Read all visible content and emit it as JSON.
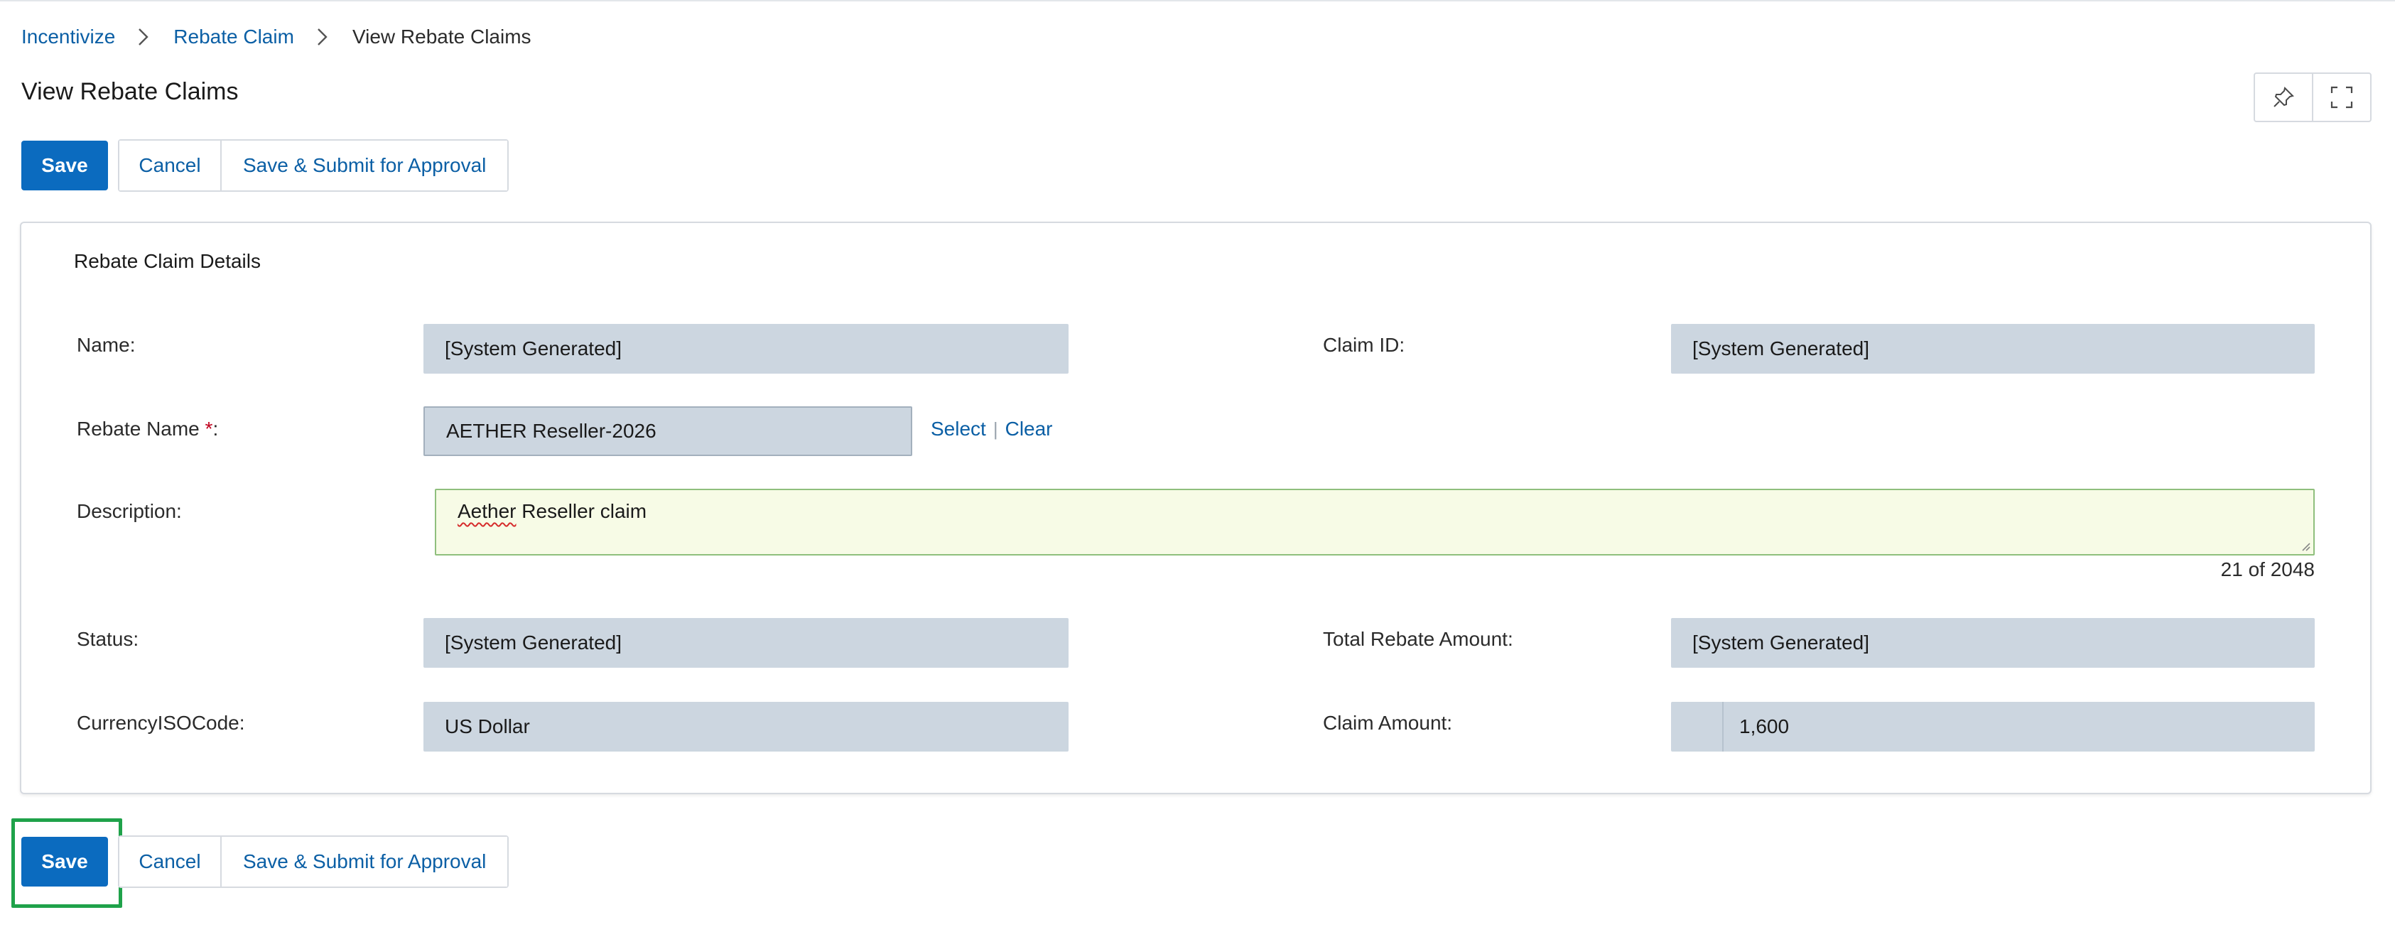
{
  "breadcrumb": {
    "items": [
      "Incentivize",
      "Rebate Claim"
    ],
    "current": "View Rebate Claims"
  },
  "page": {
    "title": "View Rebate Claims"
  },
  "icons": {
    "pin": "pin-icon",
    "fullscreen": "fullscreen-icon",
    "chevron": "chevron-right-icon"
  },
  "actions": {
    "save": "Save",
    "cancel": "Cancel",
    "submit": "Save & Submit for Approval"
  },
  "section": {
    "title": "Rebate Claim Details"
  },
  "fields": {
    "name": {
      "label": "Name:",
      "value": "[System Generated]"
    },
    "claim_id": {
      "label": "Claim ID:",
      "value": "[System Generated]"
    },
    "rebate_name": {
      "label": "Rebate Name ",
      "required": "*",
      "colon": ":",
      "value": "AETHER Reseller-2026",
      "select": "Select",
      "separator": "|",
      "clear": "Clear"
    },
    "description": {
      "label": "Description:",
      "value_first": "Aether",
      "value_rest": " Reseller claim",
      "counter": "21 of 2048"
    },
    "status": {
      "label": "Status:",
      "value": "[System Generated]"
    },
    "total_rebate": {
      "label": "Total Rebate Amount:",
      "value": "[System Generated]"
    },
    "currency": {
      "label": "CurrencyISOCode:",
      "value": "US Dollar"
    },
    "claim_amount": {
      "label": "Claim Amount:",
      "value": "1,600"
    }
  },
  "colors": {
    "primary": "#0b6bbf",
    "link": "#0b5fa5",
    "readonly_field": "#ccd6e0",
    "highlight": "#1fa24a",
    "textarea_bg": "#f7fbe6"
  }
}
